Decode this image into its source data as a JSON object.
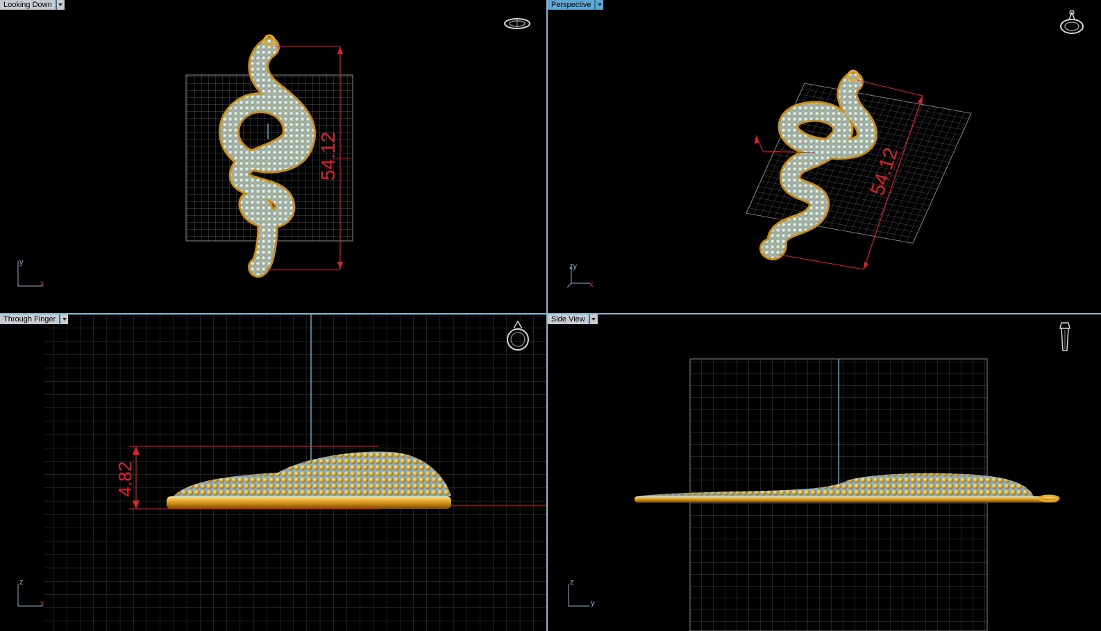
{
  "viewports": {
    "top_left": {
      "label": "Looking Down",
      "dimension": "54.12",
      "axis_v": "y",
      "axis_h": "x"
    },
    "top_right": {
      "label": "Perspective",
      "dimension": "54.12",
      "axis_v": "zy",
      "axis_h": "x"
    },
    "bottom_left": {
      "label": "Through Finger",
      "dimension": "4.82",
      "axis_v": "z",
      "axis_h": "x"
    },
    "bottom_right": {
      "label": "Side View",
      "axis_v": "z",
      "axis_h": "y"
    }
  },
  "colors": {
    "background": "#000000",
    "grid": "#6b6b6b",
    "gold": "#e5a92a",
    "gem": "#a9cfe6",
    "dimension": "#e0202a",
    "label_bg": "#8ec6e6",
    "divider": "#7fb7d4"
  },
  "icons": {
    "top_left": "ring-top-view-icon",
    "top_right": "ring-perspective-icon",
    "bottom_left": "ring-front-view-icon",
    "bottom_right": "ring-side-view-icon"
  }
}
